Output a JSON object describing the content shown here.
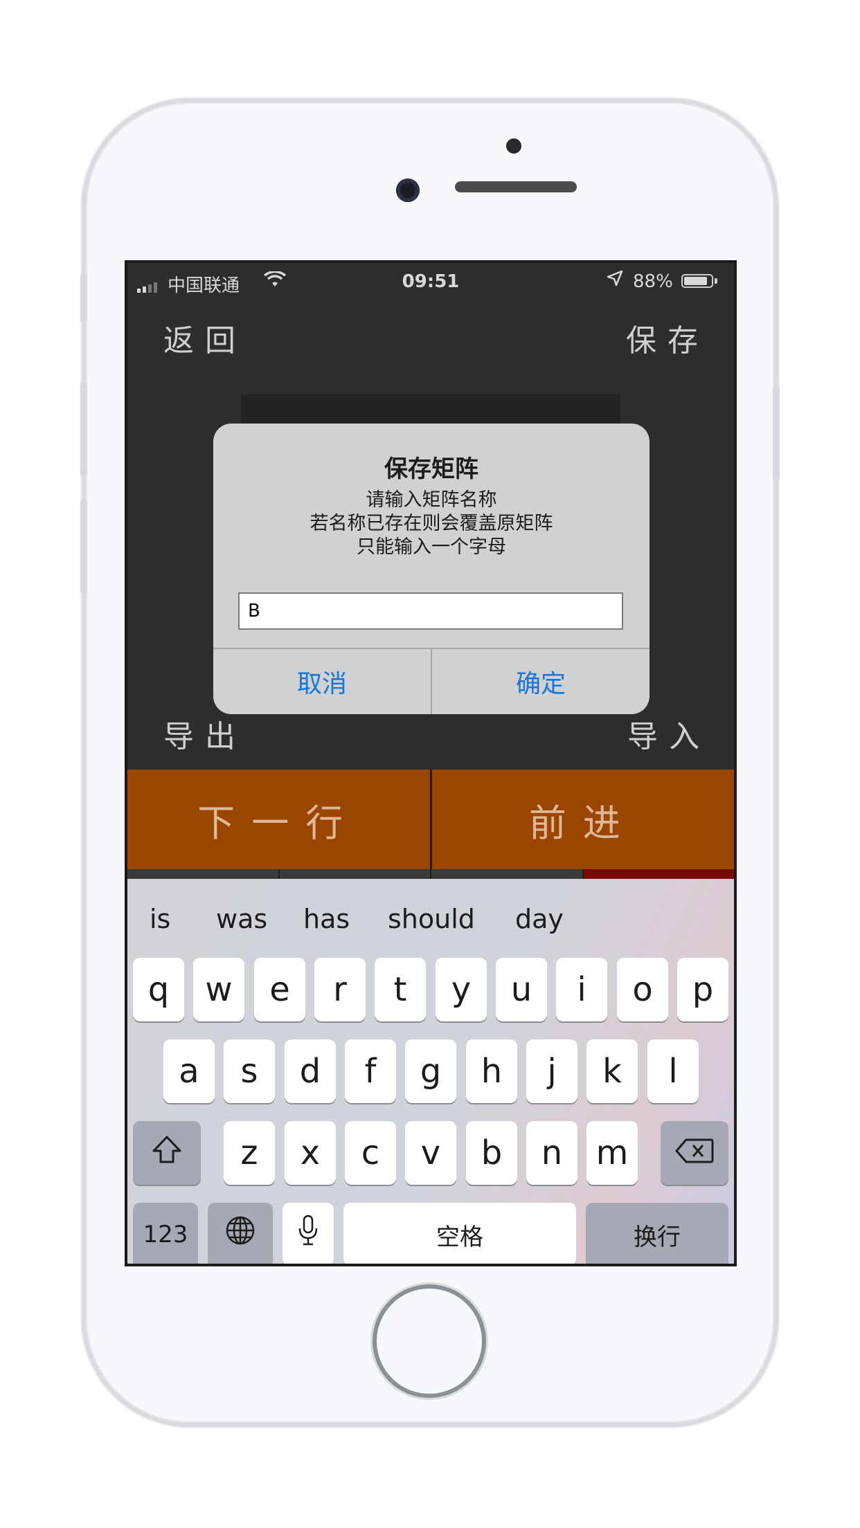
{
  "status_bar": {
    "carrier": "中国联通",
    "time": "09:51",
    "battery": "88%",
    "battery_level": 0.88,
    "icons": [
      "signal-bars-icon",
      "wifi-icon",
      "location-arrow-icon",
      "battery-icon"
    ]
  },
  "nav": {
    "back_label": "返回",
    "save_label": "保存",
    "export_label": "导出",
    "import_label": "导入"
  },
  "actions": {
    "next_row_label": "下一行",
    "forward_label": "前进"
  },
  "colors": {
    "action_button": "#9a4500",
    "alert_button_text": "#1677d6",
    "accent_red": "#7a0707"
  },
  "dialog": {
    "title": "保存矩阵",
    "message_line1": "请输入矩阵名称",
    "message_line2": "若名称已存在则会覆盖原矩阵",
    "message_line3": "只能输入一个字母",
    "input_value": "B",
    "cancel_label": "取消",
    "confirm_label": "确定"
  },
  "keyboard": {
    "suggestions": [
      "is",
      "was",
      "has",
      "should",
      "day"
    ],
    "row1": [
      "q",
      "w",
      "e",
      "r",
      "t",
      "y",
      "u",
      "i",
      "o",
      "p"
    ],
    "row2": [
      "a",
      "s",
      "d",
      "f",
      "g",
      "h",
      "j",
      "k",
      "l"
    ],
    "row3": [
      "z",
      "x",
      "c",
      "v",
      "b",
      "n",
      "m"
    ],
    "numbers_label": "123",
    "space_label": "空格",
    "return_label": "换行",
    "icons": [
      "shift-icon",
      "backspace-icon",
      "globe-icon",
      "microphone-icon"
    ]
  }
}
